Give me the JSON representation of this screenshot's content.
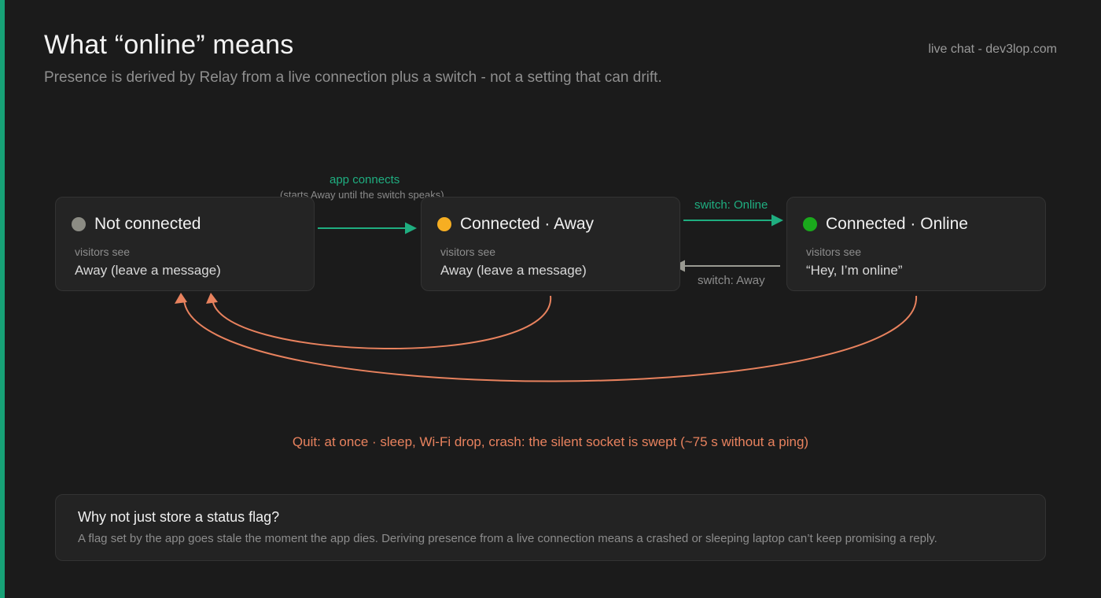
{
  "header": {
    "title": "What “online” means",
    "subtitle": "Presence is derived by Relay from a live connection plus a switch - not a setting that can drift.",
    "source": "live chat - dev3lop.com"
  },
  "states": [
    {
      "name": "Not connected",
      "dot_color": "#8c8c84",
      "visitors_label": "visitors see",
      "visitors_text": "Away (leave a message)"
    },
    {
      "name": "Connected · Away",
      "dot_color": "#f6ae22",
      "visitors_label": "visitors see",
      "visitors_text": "Away (leave a message)"
    },
    {
      "name": "Connected · Online",
      "dot_color": "#1aa91c",
      "visitors_label": "visitors see",
      "visitors_text": "“Hey, I’m online”"
    }
  ],
  "transitions": {
    "app_connects": "app connects",
    "app_connects_note": "(starts Away until the switch speaks)",
    "switch_online": "switch: Online",
    "switch_away": "switch: Away",
    "quit_note": "Quit: at once · sleep, Wi-Fi drop, crash: the silent socket is swept (~75 s without a ping)"
  },
  "info": {
    "title": "Why not just store a status flag?",
    "body": "A flag set by the app goes stale the moment the app dies. Deriving presence from a live connection means a crashed or sleeping laptop can’t keep promising a reply."
  },
  "colors": {
    "accent": "#17a277",
    "connect_arrow": "#1fae80",
    "away_arrow": "#9a9a92",
    "disconnect_arrow": "#e8825e"
  }
}
